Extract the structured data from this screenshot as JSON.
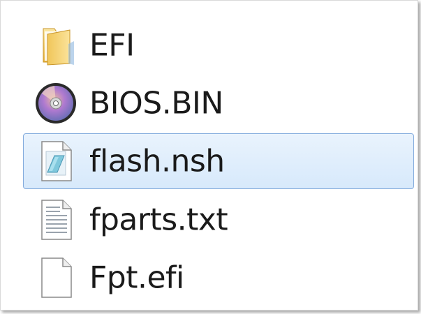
{
  "files": [
    {
      "name": "EFI",
      "icon": "folder-icon",
      "selected": false
    },
    {
      "name": "BIOS.BIN",
      "icon": "disc-image-icon",
      "selected": false
    },
    {
      "name": "flash.nsh",
      "icon": "script-file-icon",
      "selected": true
    },
    {
      "name": "fparts.txt",
      "icon": "text-file-icon",
      "selected": false
    },
    {
      "name": "Fpt.efi",
      "icon": "blank-file-icon",
      "selected": false
    }
  ],
  "colors": {
    "selection_border": "#84acdd",
    "selection_fill": "#d7e9fb",
    "folder_yellow": "#f2c94c"
  }
}
